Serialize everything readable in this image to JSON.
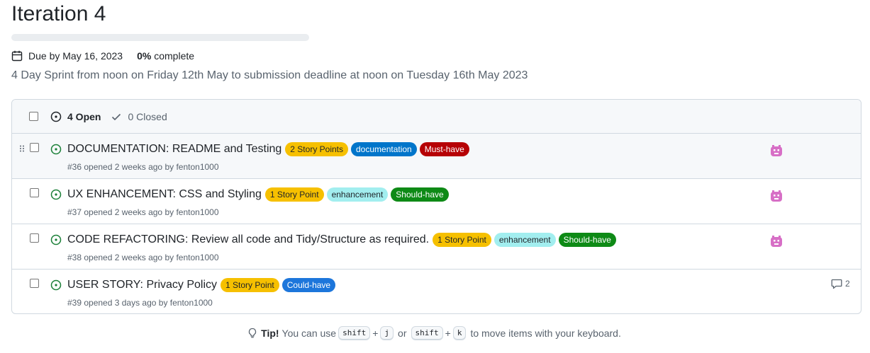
{
  "milestone": {
    "title": "Iteration 4",
    "progress": 0,
    "due": "Due by May 16, 2023",
    "percent": "0%",
    "percent_suffix": "complete",
    "description": "4 Day Sprint from noon on Friday 12th May to submission deadline at noon on Tuesday 16th May 2023"
  },
  "list_header": {
    "open_label": "4 Open",
    "closed_label": "0 Closed"
  },
  "issues": [
    {
      "title": "DOCUMENTATION: README and Testing",
      "subtitle": "#36 opened 2 weeks ago by fenton1000",
      "labels": [
        {
          "text": "2 Story Points",
          "bg": "#f6c000",
          "fg": "#1f2328"
        },
        {
          "text": "documentation",
          "bg": "#0075ca",
          "fg": "#ffffff"
        },
        {
          "text": "Must-have",
          "bg": "#b60205",
          "fg": "#ffffff"
        }
      ],
      "assignee": "avatar-icon"
    },
    {
      "title": "UX ENHANCEMENT: CSS and Styling",
      "subtitle": "#37 opened 2 weeks ago by fenton1000",
      "labels": [
        {
          "text": "1 Story Point",
          "bg": "#f6c000",
          "fg": "#1f2328"
        },
        {
          "text": "enhancement",
          "bg": "#a2eeef",
          "fg": "#1f2328"
        },
        {
          "text": "Should-have",
          "bg": "#0e8a16",
          "fg": "#ffffff"
        }
      ],
      "assignee": "avatar-icon"
    },
    {
      "title": "CODE REFACTORING: Review all code and Tidy/Structure as required.",
      "subtitle": "#38 opened 2 weeks ago by fenton1000",
      "labels": [
        {
          "text": "1 Story Point",
          "bg": "#f6c000",
          "fg": "#1f2328"
        },
        {
          "text": "enhancement",
          "bg": "#a2eeef",
          "fg": "#1f2328"
        },
        {
          "text": "Should-have",
          "bg": "#0e8a16",
          "fg": "#ffffff"
        }
      ],
      "assignee": "avatar-icon"
    },
    {
      "title": "USER STORY: Privacy Policy",
      "subtitle": "#39 opened 3 days ago by fenton1000",
      "labels": [
        {
          "text": "1 Story Point",
          "bg": "#f6c000",
          "fg": "#1f2328"
        },
        {
          "text": "Could-have",
          "bg": "#1d76db",
          "fg": "#ffffff"
        }
      ],
      "comments": "2"
    }
  ],
  "tip": {
    "lead": "Tip!",
    "text1": "You can use",
    "key1a": "shift",
    "plus": "+",
    "key1b": "j",
    "or": "or",
    "key2a": "shift",
    "key2b": "k",
    "text2": "to move items with your keyboard."
  },
  "colors": {
    "open_green": "#1a7f37",
    "avatar_pink": "#d76fc6"
  }
}
